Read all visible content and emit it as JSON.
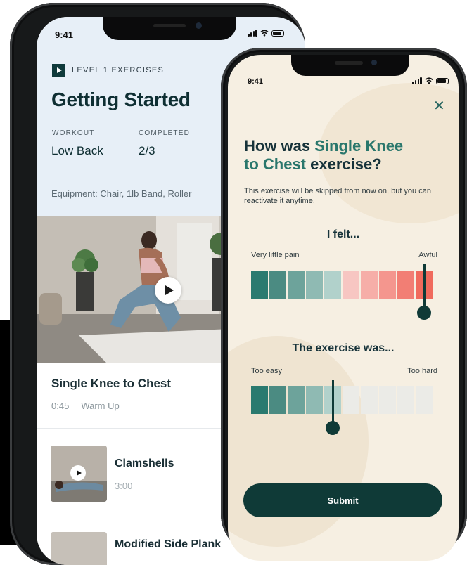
{
  "left_phone": {
    "time": "9:41",
    "level_label": "LEVEL 1 EXERCISES",
    "title": "Getting Started",
    "workout_label": "WORKOUT",
    "workout_value": "Low Back",
    "completed_label": "COMPLETED",
    "completed_value": "2/3",
    "equipment": "Equipment: Chair, 1lb Band, Roller",
    "current_exercise": {
      "name": "Single Knee to Chest",
      "duration": "0:45",
      "category": "Warm Up"
    },
    "list": [
      {
        "name": "Clamshells",
        "duration": "3:00"
      },
      {
        "name": "Modified Side Plank",
        "duration": ""
      }
    ]
  },
  "right_phone": {
    "time": "9:41",
    "close_icon": "close-icon",
    "question_prefix": "How was ",
    "question_highlight_1": "Single Knee",
    "question_highlight_2": "to Chest",
    "question_suffix": " exercise?",
    "note": "This exercise will be skipped from now on, but you can reactivate it anytime.",
    "felt_title": "I felt...",
    "felt_min_label": "Very little pain",
    "felt_max_label": "Awful",
    "felt_level": 10,
    "felt_colors": [
      "#2a7a6f",
      "#4b8b82",
      "#6da39b",
      "#8fbab3",
      "#b1d1cb",
      "#f7c6c2",
      "#f6aea8",
      "#f4968e",
      "#f27e74",
      "#f06a5c"
    ],
    "exercise_title": "The exercise was...",
    "exercise_min_label": "Too easy",
    "exercise_max_label": "Too hard",
    "exercise_level": 5,
    "exercise_colors": [
      "#2a7a6f",
      "#4b8b82",
      "#6da39b",
      "#8fbab3",
      "#b1d1cb",
      "#ebebe7",
      "#ebebe7",
      "#ebebe7",
      "#ebebe7",
      "#ebebe7"
    ],
    "submit_label": "Submit"
  }
}
